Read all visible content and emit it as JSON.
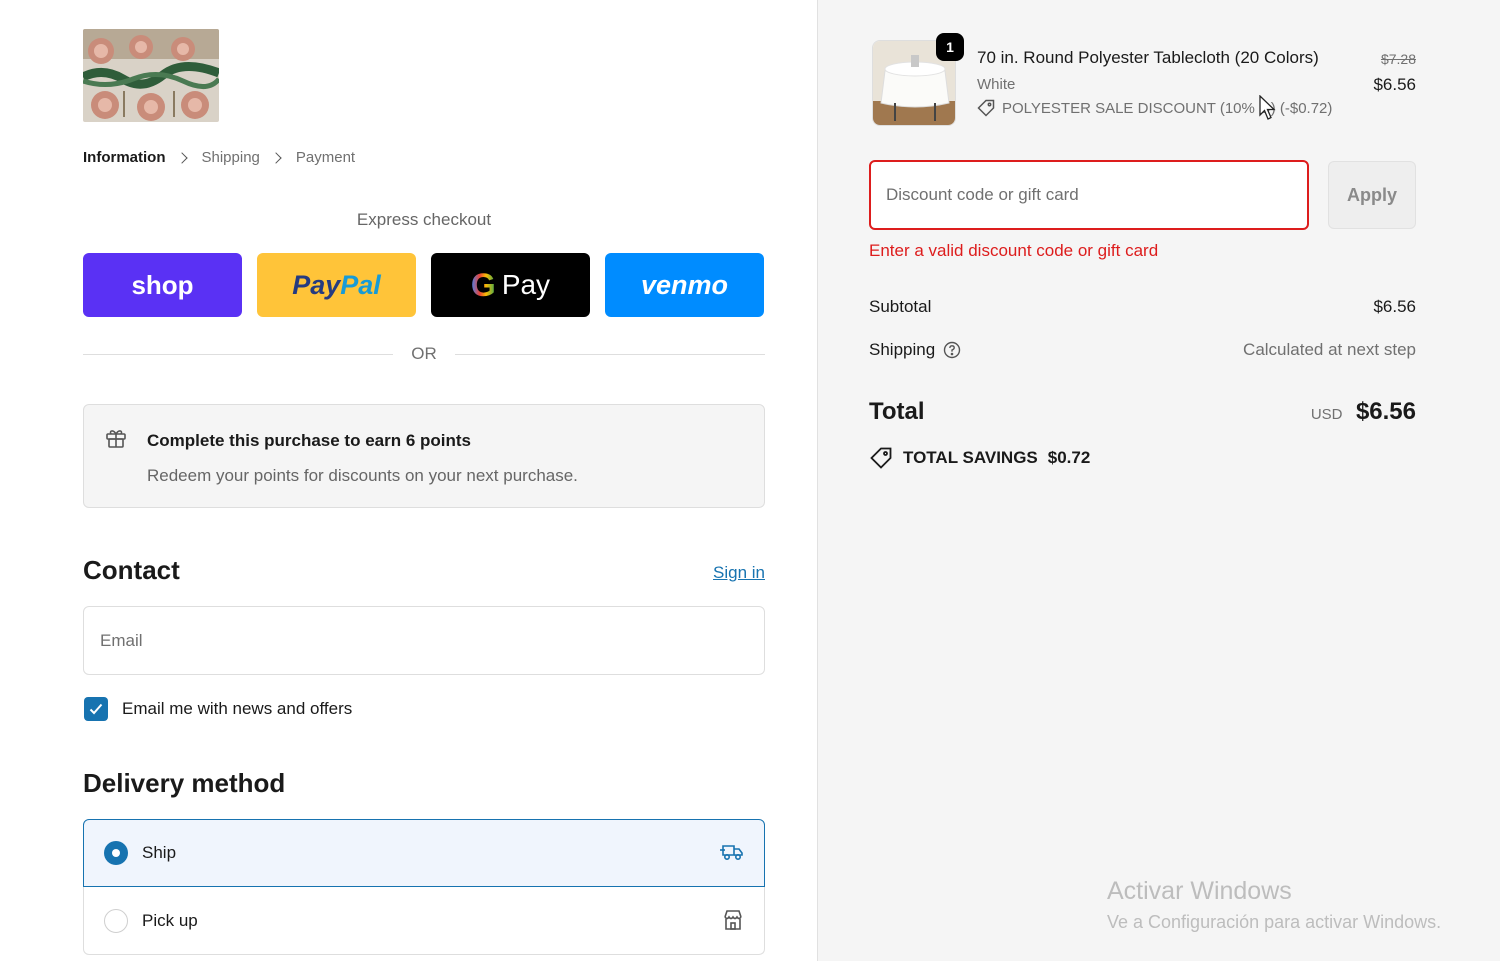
{
  "breadcrumbs": {
    "information": "Information",
    "shipping": "Shipping",
    "payment": "Payment"
  },
  "express": {
    "title": "Express checkout",
    "shop_label": "shop",
    "paypal_part1": "Pay",
    "paypal_part2": "Pal",
    "gpay_g": "G",
    "gpay_label": "Pay",
    "venmo_label": "venmo",
    "or_label": "OR"
  },
  "points": {
    "title": "Complete this purchase to earn 6 points",
    "subtitle": "Redeem your points for discounts on your next purchase."
  },
  "contact": {
    "heading": "Contact",
    "signin_label": "Sign in",
    "email_placeholder": "Email",
    "newsletter_label": "Email me with news and offers",
    "newsletter_checked": true
  },
  "delivery": {
    "heading": "Delivery method",
    "options": [
      {
        "label": "Ship",
        "selected": true,
        "icon": "truck-icon"
      },
      {
        "label": "Pick up",
        "selected": false,
        "icon": "store-icon"
      }
    ]
  },
  "order": {
    "quantity": "1",
    "product_name": "70 in. Round Polyester Tablecloth (20 Colors)",
    "variant": "White",
    "discount_line": "POLYESTER SALE DISCOUNT (10% O",
    "discount_line_tail": ") (-$0.72)",
    "original_price": "$7.28",
    "price": "$6.56"
  },
  "discount": {
    "placeholder": "Discount code or gift card",
    "apply_label": "Apply",
    "error": "Enter a valid discount code or gift card"
  },
  "summary": {
    "subtotal_label": "Subtotal",
    "subtotal_value": "$6.56",
    "shipping_label": "Shipping",
    "shipping_value": "Calculated at next step",
    "total_label": "Total",
    "currency": "USD",
    "total_value": "$6.56",
    "savings_label": "TOTAL SAVINGS",
    "savings_value": "$0.72"
  },
  "watermark": {
    "line1": "Activar Windows",
    "line2": "Ve a Configuración para activar Windows."
  },
  "colors": {
    "accent": "#1773b0",
    "error": "#dd1d1d",
    "shop": "#5a31f4",
    "paypal": "#ffc439",
    "gpay": "#000000",
    "venmo": "#008cff"
  }
}
